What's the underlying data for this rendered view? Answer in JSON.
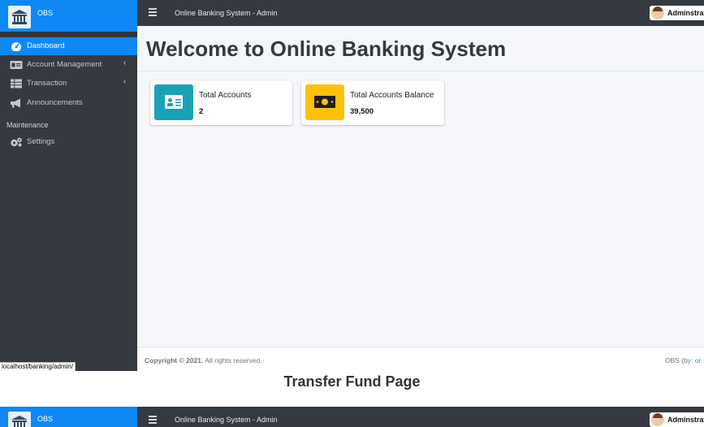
{
  "brand": {
    "name": "OBS"
  },
  "topbar": {
    "title": "Online Banking System - Admin",
    "user": "Adminstrat"
  },
  "sidebar": {
    "items": [
      {
        "label": "Dashboard",
        "icon": "dashboard-icon",
        "active": true
      },
      {
        "label": "Account Management",
        "icon": "id-card-icon",
        "chevron": "‹"
      },
      {
        "label": "Transaction",
        "icon": "table-icon",
        "chevron": "‹"
      },
      {
        "label": "Announcements",
        "icon": "megaphone-icon"
      }
    ],
    "section_header": "Maintenance",
    "settings": {
      "label": "Settings",
      "icon": "gears-icon"
    }
  },
  "main": {
    "title": "Welcome to Online Banking System",
    "cards": [
      {
        "label": "Total Accounts",
        "value": "2",
        "icon": "id-card-icon",
        "color": "#17a2b8"
      },
      {
        "label": "Total Accounts Balance",
        "value": "39,500",
        "icon": "money-icon",
        "color": "#ffc107"
      }
    ]
  },
  "footer": {
    "copyright": "Copyright © 2021.",
    "rights": "All rights reserved.",
    "credit": "OBS (by:",
    "credit_link": "or"
  },
  "statusbar": {
    "url": "localhost/banking/admin/"
  },
  "caption": "Transfer Fund Page",
  "second": {
    "brand": "OBS",
    "title": "Online Banking System - Admin",
    "user": "Adminstrat"
  },
  "colors": {
    "primary": "#0d88f5",
    "sidebar": "#343a40",
    "info": "#17a2b8",
    "warning": "#ffc107"
  }
}
